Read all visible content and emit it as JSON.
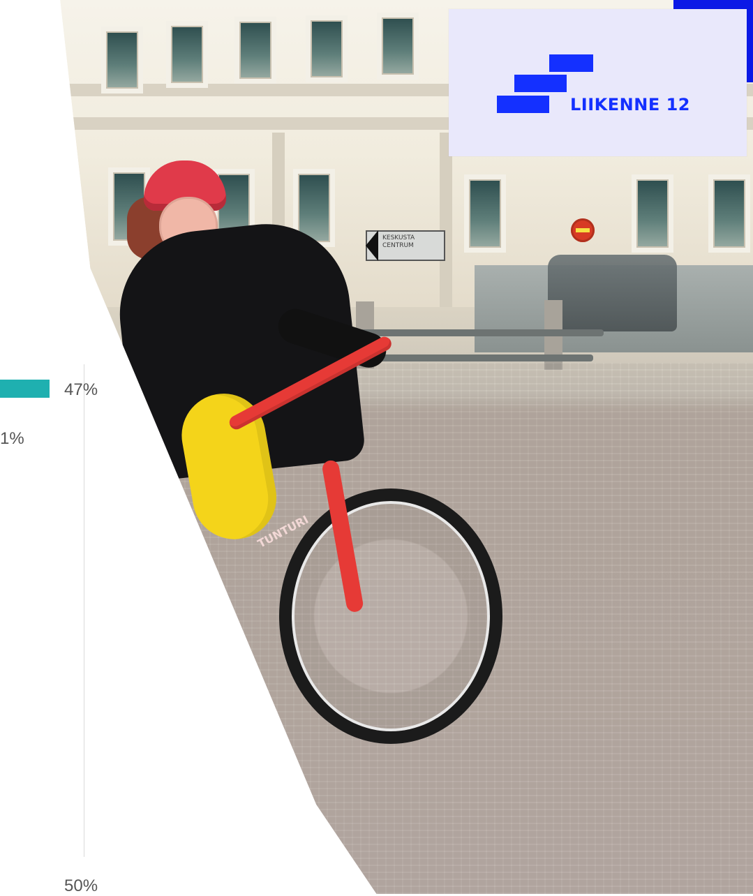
{
  "chart": {
    "tick_label": "50%",
    "bar_label": "47%",
    "partial_label": "1%"
  },
  "logo": {
    "text": "LIIKENNE 12"
  },
  "street_sign": {
    "line1": "KESKUSTA",
    "line2": "CENTRUM"
  },
  "bike": {
    "brand": "TUNTURI"
  },
  "chart_data": {
    "type": "bar",
    "categories": [
      "",
      ""
    ],
    "values": [
      47,
      1
    ],
    "ylim": [
      0,
      50
    ]
  }
}
